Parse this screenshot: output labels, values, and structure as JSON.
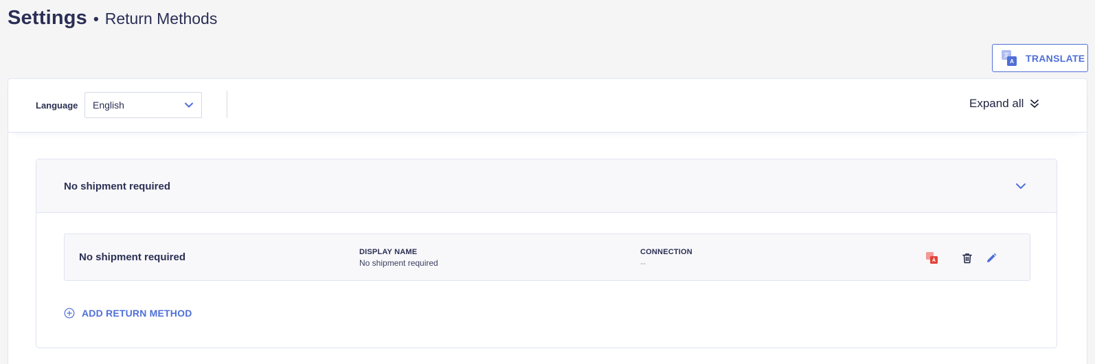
{
  "header": {
    "title": "Settings",
    "separator": "•",
    "subtitle": "Return Methods"
  },
  "translate_button": {
    "label": "TRANSLATE",
    "icon": "translate-icon",
    "icon_back_glyph": "文",
    "icon_front_glyph": "A"
  },
  "toolbar": {
    "language_label": "Language",
    "language_selected": "English",
    "expand_all_label": "Expand all"
  },
  "group": {
    "title": "No shipment required",
    "methods": [
      {
        "name": "No shipment required",
        "display_name_header": "DISPLAY NAME",
        "display_name_value": "No shipment required",
        "connection_header": "CONNECTION",
        "connection_value": "--"
      }
    ]
  },
  "add_method": {
    "label": "ADD RETURN METHOD"
  },
  "colors": {
    "accent": "#4f6fd6",
    "text": "#2a2f52",
    "danger": "#e0433a",
    "background": "#f5f5f6"
  }
}
